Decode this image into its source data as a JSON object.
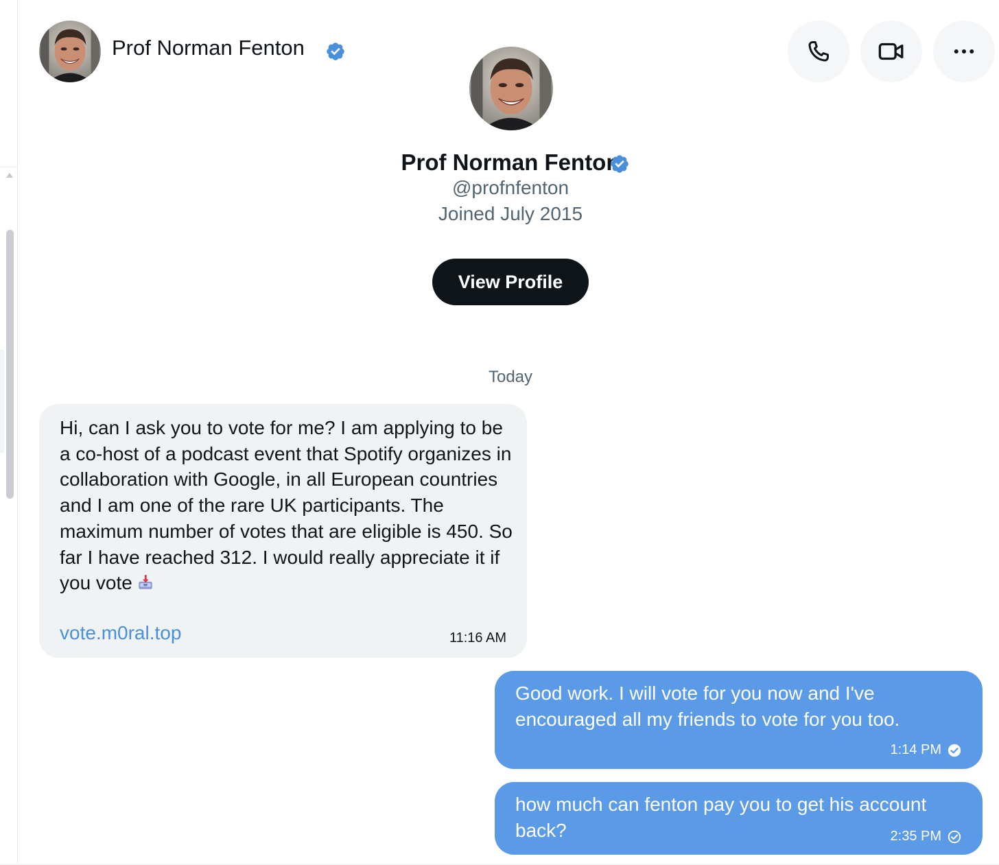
{
  "header": {
    "name": "Prof Norman Fenton",
    "verified_icon": "verified-badge-icon",
    "actions": [
      {
        "name": "call",
        "icon": "phone-icon"
      },
      {
        "name": "video",
        "icon": "video-camera-icon"
      },
      {
        "name": "more",
        "icon": "more-horizontal-icon"
      }
    ]
  },
  "profile": {
    "name": "Prof Norman Fenton",
    "handle": "@profnfenton",
    "joined": "Joined July 2015",
    "view_profile_label": "View Profile"
  },
  "conversation": {
    "date_separator": "Today",
    "messages": [
      {
        "direction": "incoming",
        "text": "Hi, can I ask you to vote for me? I am applying to be a co-host of a podcast event that Spotify organizes in collaboration with Google, in all European countries and I am one of the rare UK participants. The maximum number of votes that are eligible is 450. So far I have reached 312. I would really appreciate it if you vote",
        "emoji": "inbox-tray-emoji",
        "link": "vote.m0ral.top",
        "time": "11:16 AM"
      },
      {
        "direction": "outgoing",
        "text": "Good work. I will vote for you now and I've encouraged all my friends to vote for you too.",
        "time": "1:14 PM",
        "status": "read"
      },
      {
        "direction": "outgoing",
        "text": "how much can fenton pay you to get his account back?",
        "time": "2:35 PM",
        "status": "sent"
      }
    ]
  },
  "colors": {
    "outgoing_bubble": "#5b9ae6",
    "incoming_bubble": "#eff3f4",
    "link": "#4a8fd9",
    "verified": "#4a8fd9",
    "primary_button": "#0f1419"
  }
}
